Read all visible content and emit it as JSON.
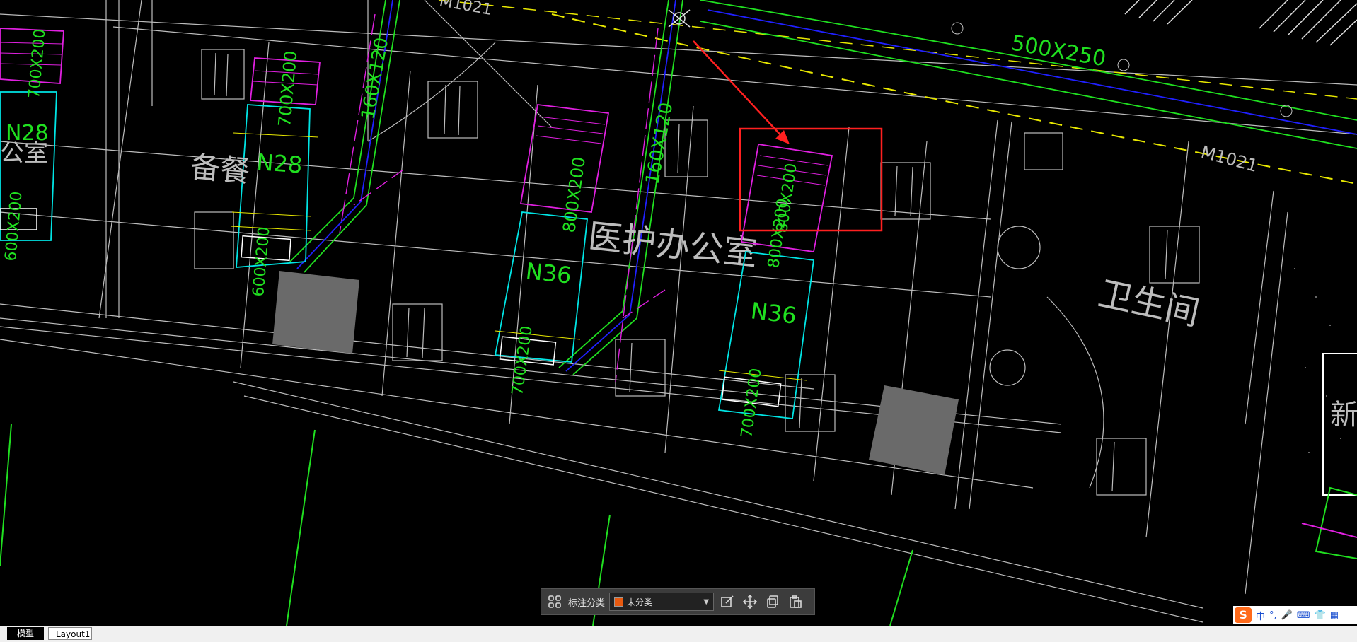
{
  "drawing": {
    "labels": {
      "duct_main": "500X250",
      "door_top": "M1021",
      "door_right": "M1021",
      "vert_duct_1": "160X120",
      "vert_duct_2": "160X120",
      "unit_n28_left": "N28",
      "unit_n28": "N28",
      "unit_n36_a": "N36",
      "unit_n36_b": "N36",
      "size_700x200_left": "700X200",
      "size_700x200": "700X200",
      "size_600x200_left": "600X200",
      "size_600x200": "600X200",
      "size_800x200_a1": "800X200",
      "size_800x200_a2": "800X200",
      "size_800x200_b1": "800X200",
      "size_800x200_b2": "800X200",
      "size_700x200_a": "700X200",
      "size_700x200_b": "700X200",
      "room_pantry": "备餐",
      "room_office_partial": "公室",
      "room_nurse_office": "医护办公室",
      "room_restroom": "卫生间",
      "room_edge_partial": "新"
    },
    "colors": {
      "background": "#000000",
      "walls": "#bdbdbd",
      "duct_cyan": "#00e5e5",
      "duct_magenta": "#e020e0",
      "pipe_green": "#20e020",
      "pipe_blue": "#2020ff",
      "dim_yellow": "#e8e800",
      "highlight_red": "#ff2020",
      "column_gray": "#6a6a6a"
    }
  },
  "toolbar": {
    "grid_icon": "grid-icon",
    "label": "标注分类",
    "select_value": "未分类",
    "select_color": "#e85a10",
    "edit_icon": "edit-icon",
    "move_icon": "move-icon",
    "copy_icon": "copy-icon",
    "paste_icon": "paste-icon"
  },
  "tabs": {
    "model": "模型",
    "layout": "Layout1"
  },
  "ime": {
    "logo": "S",
    "lang": "中",
    "punct": "°,",
    "mic_icon": "microphone-icon",
    "keyboard_icon": "keyboard-icon",
    "skin_icon": "shirt-icon",
    "tools_icon": "tools-icon"
  }
}
